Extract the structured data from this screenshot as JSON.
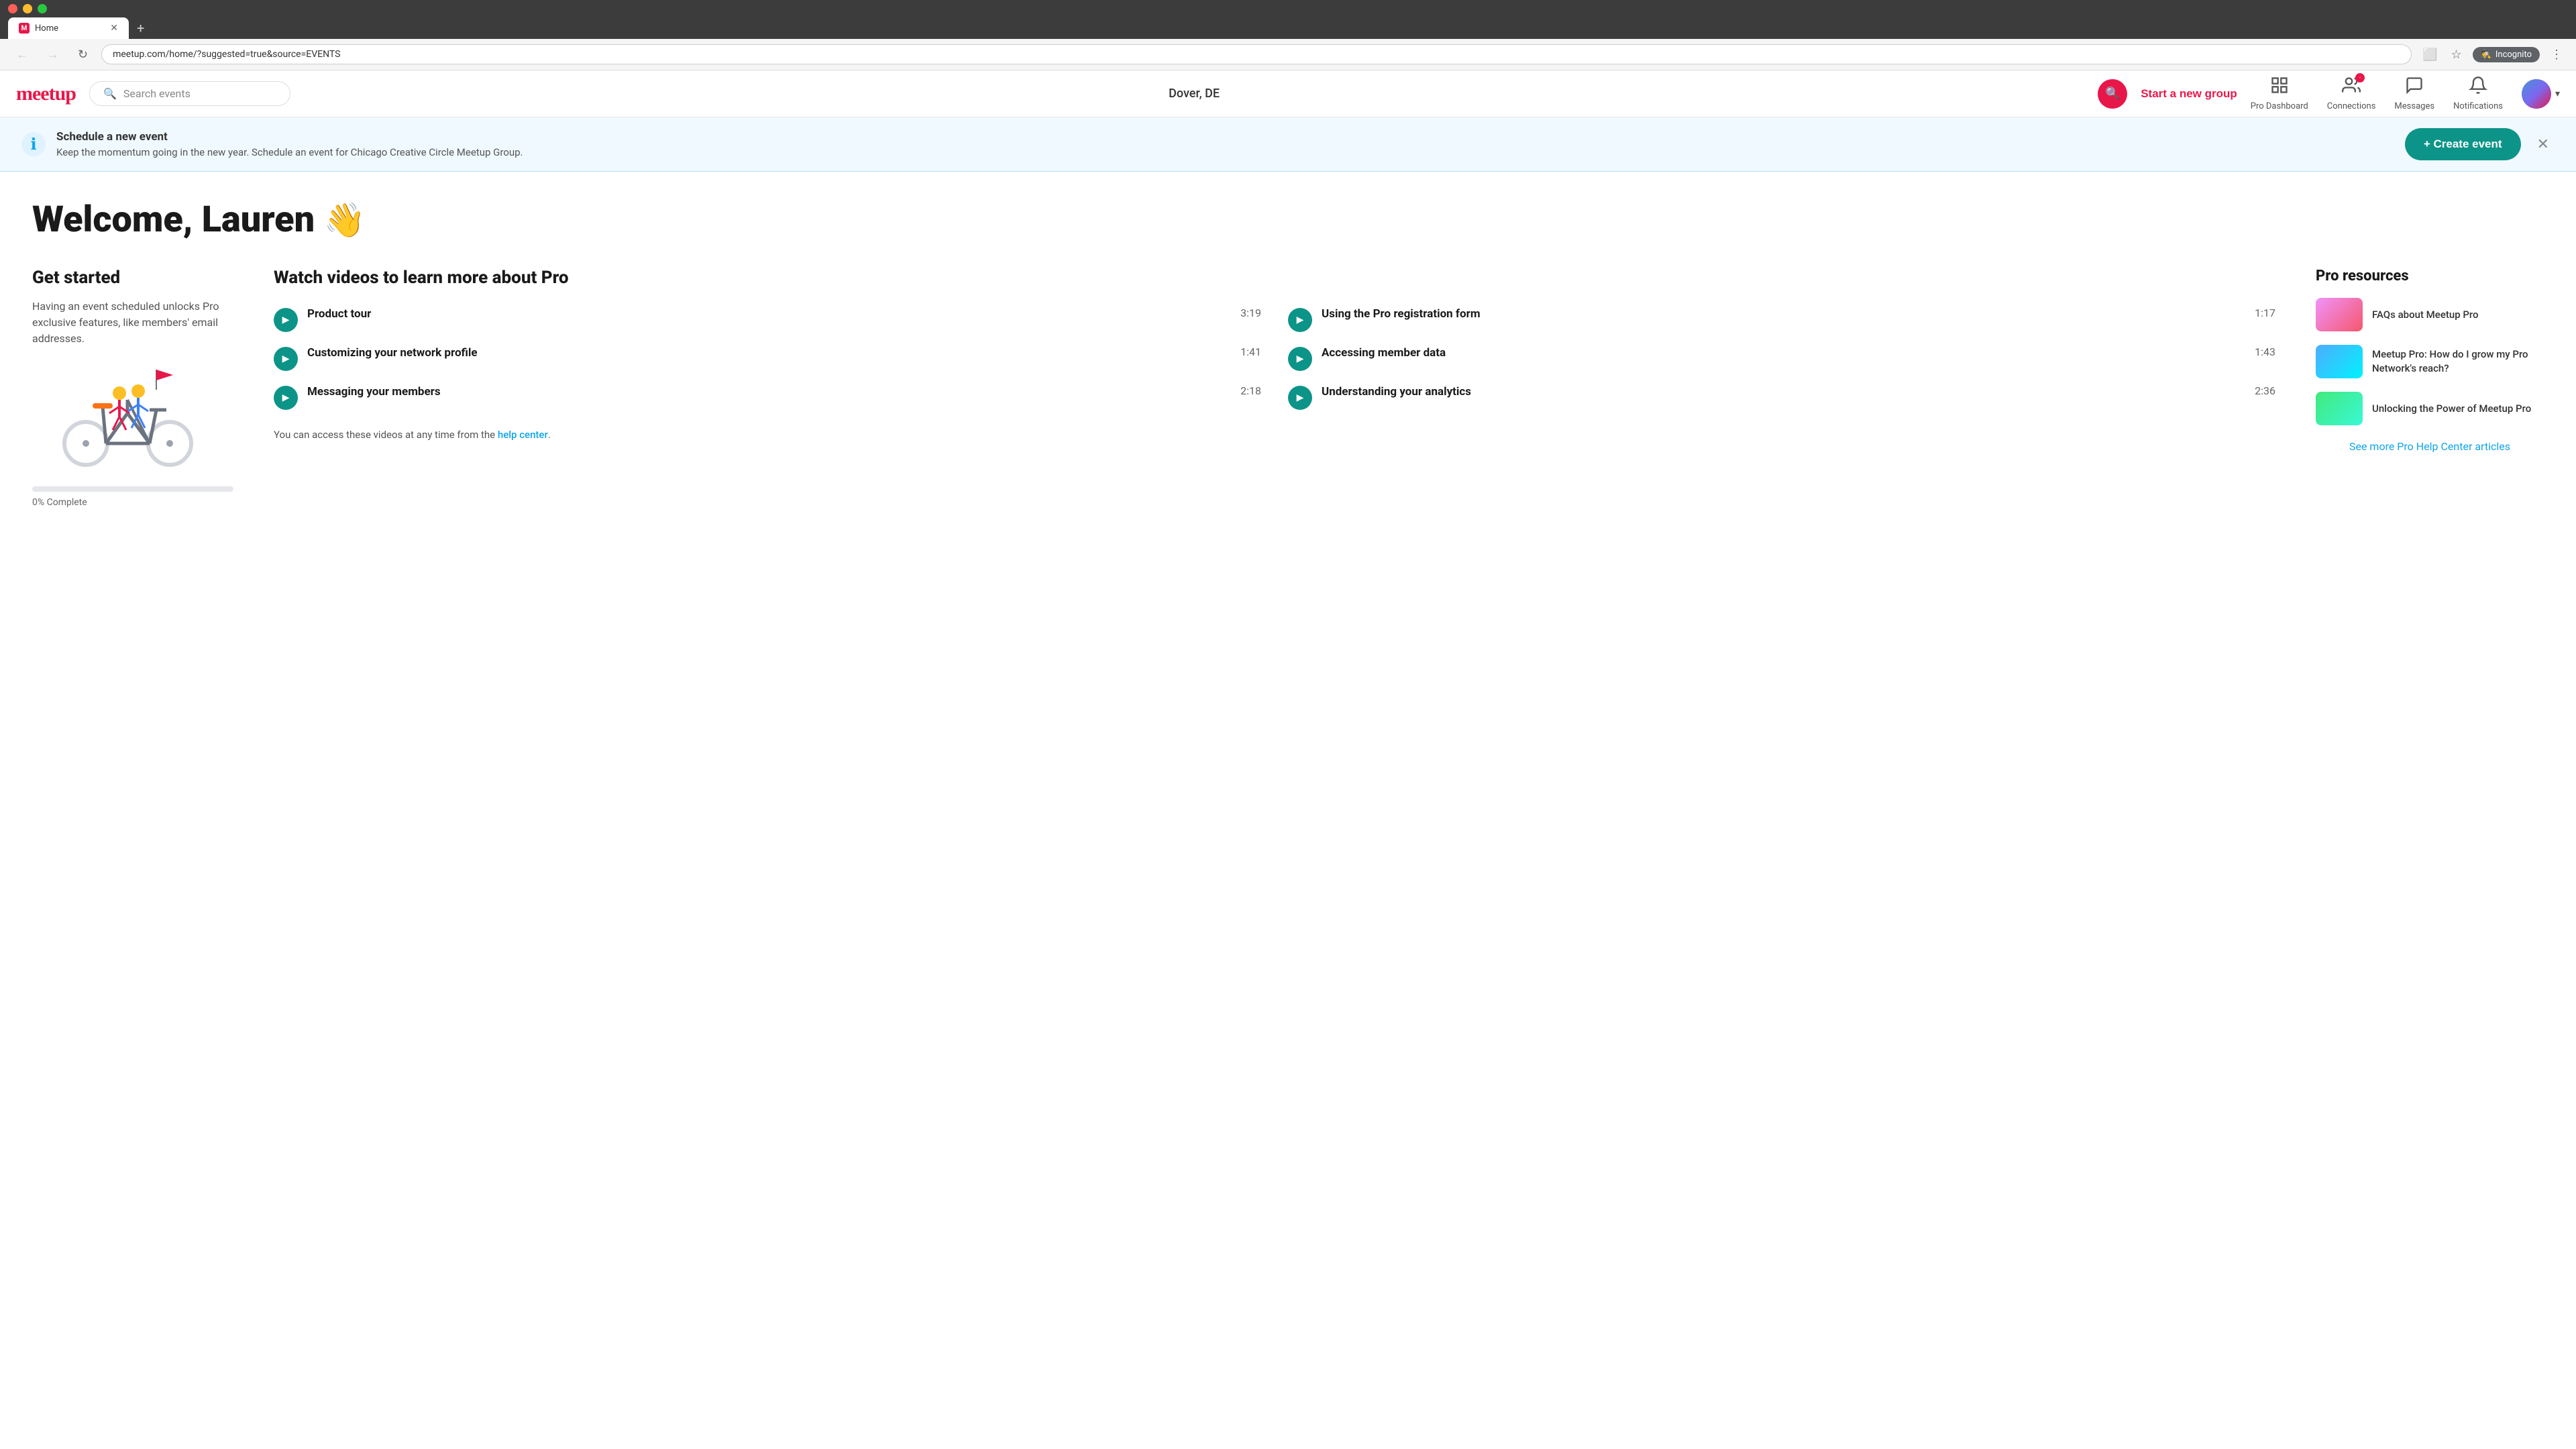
{
  "browser": {
    "url": "meetup.com/home/?suggested=true&source=EVENTS",
    "tab_title": "Home",
    "incognito_label": "Incognito"
  },
  "header": {
    "logo": "meetup",
    "search_placeholder": "Search events",
    "location": "Dover, DE",
    "start_group_label": "Start a new group",
    "nav": {
      "pro_dashboard": "Pro Dashboard",
      "connections": "Connections",
      "messages": "Messages",
      "notifications": "Notifications"
    }
  },
  "banner": {
    "title": "Schedule a new event",
    "text": "Keep the momentum going in the new year. Schedule an event for Chicago Creative Circle Meetup Group.",
    "create_btn": "+ Create event"
  },
  "welcome": {
    "heading": "Welcome, Lauren",
    "emoji": "👋"
  },
  "get_started": {
    "title": "Get started",
    "description": "Having an event scheduled unlocks Pro exclusive features, like members' email addresses.",
    "progress_percent": 0,
    "progress_label": "0% Complete"
  },
  "videos": {
    "section_title": "Watch videos to learn more about Pro",
    "items": [
      {
        "title": "Product tour",
        "duration": "3:19"
      },
      {
        "title": "Using the Pro registration form",
        "duration": "1:17"
      },
      {
        "title": "Customizing your network profile",
        "duration": "1:41"
      },
      {
        "title": "Accessing member data",
        "duration": "1:43"
      },
      {
        "title": "Messaging your members",
        "duration": "2:18"
      },
      {
        "title": "Understanding your analytics",
        "duration": "2:36"
      }
    ],
    "help_text_prefix": "You can access these videos at any time from the ",
    "help_link_text": "help center",
    "help_text_suffix": "."
  },
  "pro_resources": {
    "title": "Pro resources",
    "items": [
      {
        "title": "FAQs about Meetup Pro",
        "thumb_class": "thumb-1"
      },
      {
        "title": "Meetup Pro: How do I grow my Pro Network's reach?",
        "thumb_class": "thumb-2"
      },
      {
        "title": "Unlocking the Power of Meetup Pro",
        "thumb_class": "thumb-3"
      }
    ],
    "see_more_label": "See more Pro Help Center articles"
  }
}
